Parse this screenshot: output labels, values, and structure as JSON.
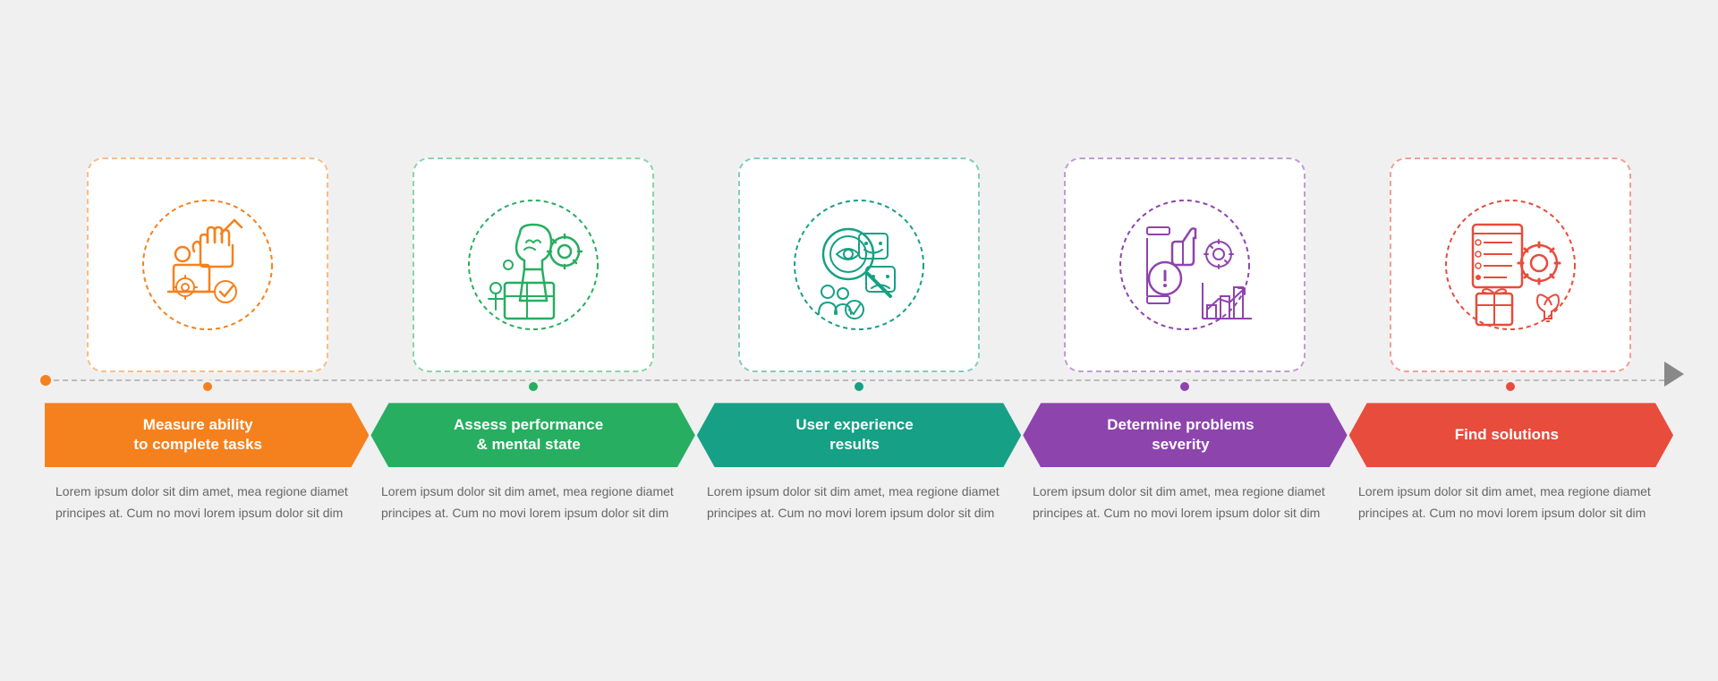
{
  "bg": "#f0f0f0",
  "accent": "#f5811e",
  "items": [
    {
      "id": 1,
      "title": "Measure ability\nto complete tasks",
      "color": "#f5811e",
      "dotColor": "#f5811e",
      "icon": "task",
      "desc": "Lorem ipsum dolor sit dim amet, mea regione diamet principes at. Cum no movi lorem ipsum dolor sit dim"
    },
    {
      "id": 2,
      "title": "Assess performance\n& mental state",
      "color": "#27ae60",
      "dotColor": "#27ae60",
      "icon": "mental",
      "desc": "Lorem ipsum dolor sit dim amet, mea regione diamet principes at. Cum no movi lorem ipsum dolor sit dim"
    },
    {
      "id": 3,
      "title": "User experience\nresults",
      "color": "#16a085",
      "dotColor": "#16a085",
      "icon": "ux",
      "desc": "Lorem ipsum dolor sit dim amet, mea regione diamet principes at. Cum no movi lorem ipsum dolor sit dim"
    },
    {
      "id": 4,
      "title": "Determine problems\nseverity",
      "color": "#8e44ad",
      "dotColor": "#8e44ad",
      "icon": "problems",
      "desc": "Lorem ipsum dolor sit dim amet, mea regione diamet principes at. Cum no movi lorem ipsum dolor sit dim"
    },
    {
      "id": 5,
      "title": "Find solutions",
      "color": "#e74c3c",
      "dotColor": "#e74c3c",
      "icon": "solutions",
      "desc": "Lorem ipsum dolor sit dim amet, mea regione diamet principes at. Cum no movi lorem ipsum dolor sit dim"
    }
  ]
}
